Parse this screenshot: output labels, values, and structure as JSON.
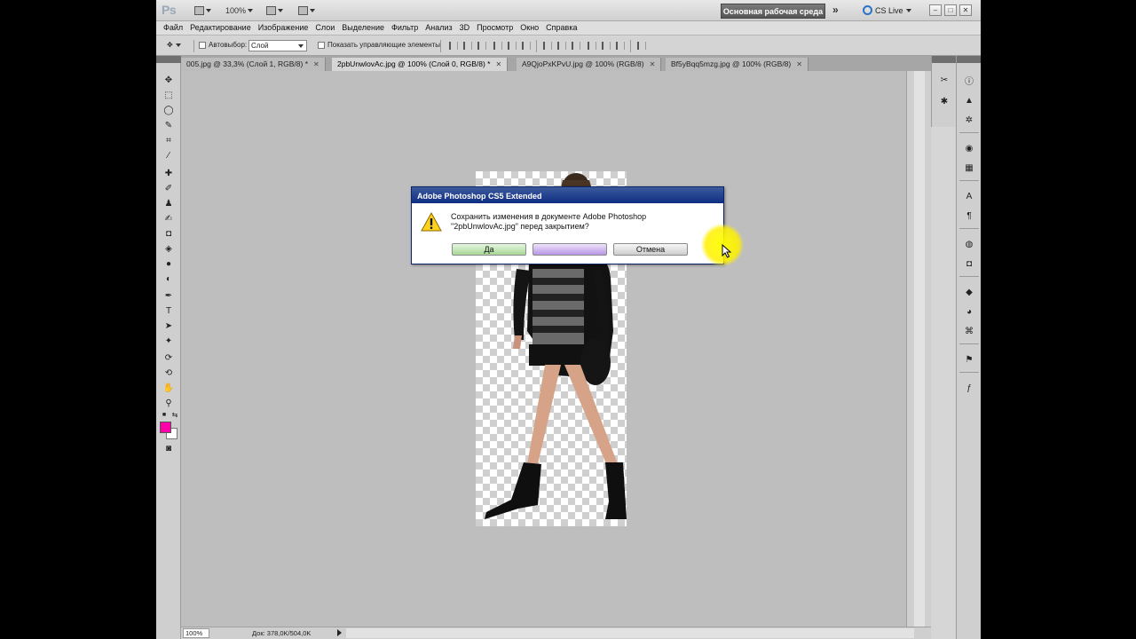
{
  "appbar": {
    "logo": "Ps",
    "zoom": "100%",
    "workspace": "Основная рабочая среда",
    "cs_live": "CS Live"
  },
  "menu": [
    "Файл",
    "Редактирование",
    "Изображение",
    "Слои",
    "Выделение",
    "Фильтр",
    "Анализ",
    "3D",
    "Просмотр",
    "Окно",
    "Справка"
  ],
  "options": {
    "autoselect_label": "Автовыбор:",
    "autoselect_value": "Слой",
    "show_controls_label": "Показать управляющие элементы"
  },
  "tabs": [
    {
      "label": "005.jpg @ 33,3% (Слой 1, RGB/8) *",
      "active": false
    },
    {
      "label": "2pbUnwlovAc.jpg @ 100% (Слой 0, RGB/8) *",
      "active": true
    },
    {
      "label": "A9QjoPxKPvU.jpg @ 100% (RGB/8)",
      "active": false
    },
    {
      "label": "Bf5yBqq5mzg.jpg @ 100% (RGB/8)",
      "active": false
    }
  ],
  "status": {
    "zoom": "100%",
    "doc_info": "Док: 378,0K/504,0K"
  },
  "dialog": {
    "title": "Adobe Photoshop CS5 Extended",
    "message_line1": "Сохранить изменения в документе Adobe Photoshop",
    "message_line2": "\"2pbUnwlovAc.jpg\" перед закрытием?",
    "yes": "Да",
    "no": "",
    "cancel": "Отмена"
  },
  "colors": {
    "foreground": "#ff00a8",
    "background": "#ffffff",
    "workspace_button": "#5a5a5a",
    "dialog_title": "#0d2d82"
  },
  "icons": {
    "tools": [
      "move-tool-icon",
      "marquee-tool-icon",
      "lasso-tool-icon",
      "quick-select-tool-icon",
      "crop-tool-icon",
      "eyedropper-tool-icon",
      "healing-brush-tool-icon",
      "brush-tool-icon",
      "clone-stamp-tool-icon",
      "history-brush-tool-icon",
      "eraser-tool-icon",
      "paint-bucket-tool-icon",
      "blur-tool-icon",
      "dodge-tool-icon",
      "pen-tool-icon",
      "type-tool-icon",
      "path-select-tool-icon",
      "shape-tool-icon",
      "3d-rotate-tool-icon",
      "3d-orbit-tool-icon",
      "hand-tool-icon",
      "zoom-tool-icon"
    ],
    "panels": [
      "info-panel-icon",
      "histogram-panel-icon",
      "navigator-panel-icon",
      "color-panel-icon",
      "swatches-panel-icon",
      "character-panel-icon",
      "paragraph-panel-icon",
      "adjustments-panel-icon",
      "masks-panel-icon",
      "layers-panel-icon",
      "channels-panel-icon",
      "paths-panel-icon",
      "clone-source-panel-icon",
      "actions-panel-icon"
    ]
  }
}
